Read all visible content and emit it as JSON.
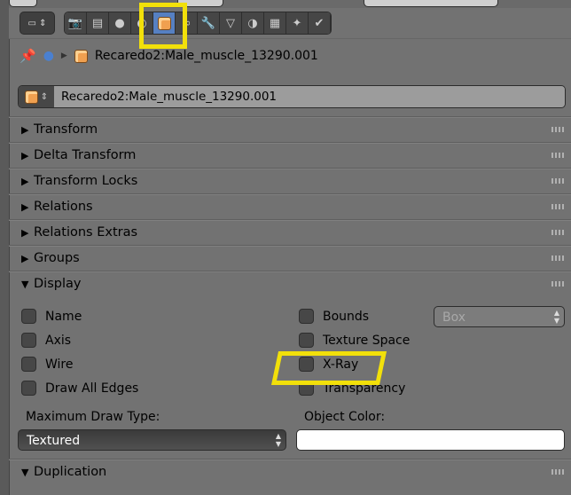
{
  "header": {
    "object_name": "Recaredo2:Male_muscle_13290.001",
    "datablock_name": "Recaredo2:Male_muscle_13290.001"
  },
  "tabs": [
    {
      "name": "render",
      "glyph": "📷"
    },
    {
      "name": "render-layers",
      "glyph": "▤"
    },
    {
      "name": "scene",
      "glyph": "●"
    },
    {
      "name": "world",
      "glyph": "◐"
    },
    {
      "name": "object",
      "glyph": "▣",
      "active": true
    },
    {
      "name": "constraints",
      "glyph": "∞"
    },
    {
      "name": "modifiers",
      "glyph": "🔧"
    },
    {
      "name": "data",
      "glyph": "▽"
    },
    {
      "name": "material",
      "glyph": "◑"
    },
    {
      "name": "texture",
      "glyph": "▦"
    },
    {
      "name": "particles",
      "glyph": "✦"
    },
    {
      "name": "physics",
      "glyph": "✔"
    }
  ],
  "panels": [
    "Transform",
    "Delta Transform",
    "Transform Locks",
    "Relations",
    "Relations Extras",
    "Groups",
    "Display"
  ],
  "display": {
    "left_checks": [
      "Name",
      "Axis",
      "Wire",
      "Draw All Edges"
    ],
    "right_checks": [
      "Bounds",
      "Texture Space",
      "X-Ray",
      "Transparency"
    ],
    "bounds_type": "Box",
    "max_draw_label": "Maximum Draw Type:",
    "max_draw_value": "Textured",
    "object_color_label": "Object Color:",
    "object_color": "#ffffff"
  },
  "duplication": "Duplication",
  "highlight_color": "#f2e00a"
}
